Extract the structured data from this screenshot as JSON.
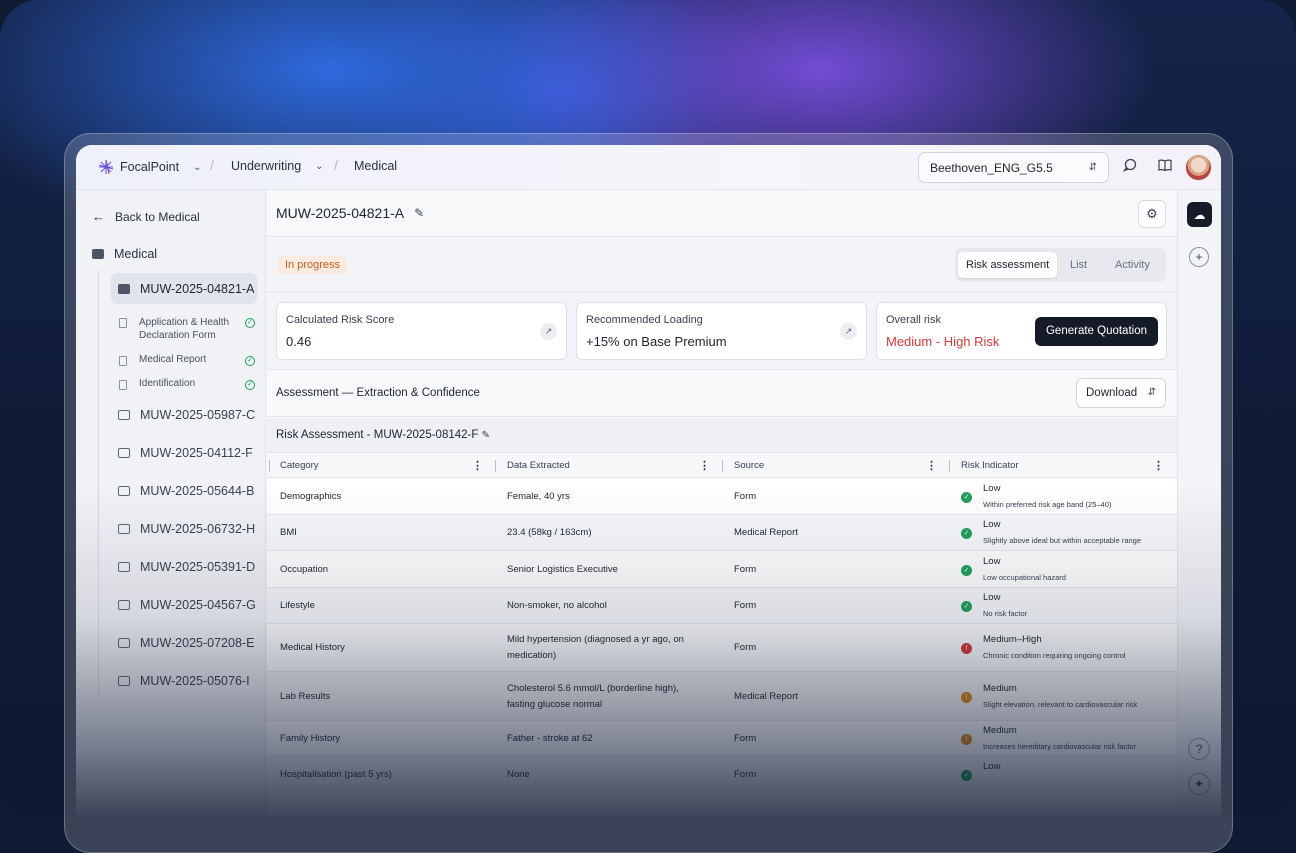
{
  "topbar": {
    "brand": "FocalPoint",
    "crumb2": "Underwriting",
    "crumb3": "Medical",
    "workspace": "Beethoven_ENG_G5.5"
  },
  "sidebar": {
    "back_label": "Back to Medical",
    "root_folder": "Medical",
    "active_case": "MUW-2025-04821-A",
    "documents": [
      {
        "label": "Application & Health Declaration Form"
      },
      {
        "label": "Medical Report"
      },
      {
        "label": "Identification"
      }
    ],
    "cases": [
      "MUW-2025-05987-C",
      "MUW-2025-04112-F",
      "MUW-2025-05644-B",
      "MUW-2025-06732-H",
      "MUW-2025-05391-D",
      "MUW-2025-04567-G",
      "MUW-2025-07208-E",
      "MUW-2025-05076-I"
    ]
  },
  "main": {
    "case_title": "MUW-2025-04821-A",
    "status": "In progress",
    "tabs": [
      "Risk assessment",
      "List",
      "Activity"
    ],
    "cards": {
      "score_label": "Calculated Risk Score",
      "score_value": "0.46",
      "loading_label": "Recommended Loading",
      "loading_value": "+15% on Base Premium",
      "overall_label": "Overall risk",
      "overall_value": "Medium - High Risk",
      "generate_button": "Generate Quotation"
    },
    "assessment_title": "Assessment — Extraction & Confidence",
    "download_label": "Download",
    "table_title": "Risk Assessment - MUW-2025-08142-F",
    "columns": [
      "Category",
      "Data Extracted",
      "Source",
      "Risk Indicator"
    ],
    "rows": [
      {
        "category": "Demographics",
        "data": "Female, 40 yrs",
        "source": "Form",
        "level": "Low",
        "desc": "Within preferred risk age band (25–40)",
        "status": "ok"
      },
      {
        "category": "BMI",
        "data": "23.4 (58kg / 163cm)",
        "source": "Medical Report",
        "level": "Low",
        "desc": "Slightly above ideal but within acceptable range",
        "status": "ok"
      },
      {
        "category": "Occupation",
        "data": "Senior Logistics Executive",
        "source": "Form",
        "level": "Low",
        "desc": "Low occupational hazard",
        "status": "ok"
      },
      {
        "category": "Lifestyle",
        "data": "Non-smoker, no alcohol",
        "source": "Form",
        "level": "Low",
        "desc": "No risk factor",
        "status": "ok"
      },
      {
        "category": "Medical History",
        "data": "Mild hypertension (diagnosed a yr ago, on medication)",
        "source": "Form",
        "level": "Medium–High",
        "desc": "Chronic condition requiring ongoing control",
        "status": "high"
      },
      {
        "category": "Lab Results",
        "data": "Cholesterol 5.6 mmol/L (borderline high), fasting glucose normal",
        "source": "Medical Report",
        "level": "Medium",
        "desc": "Slight elevation, relevant to cardiovascular risk",
        "status": "medium"
      },
      {
        "category": "Family History",
        "data": "Father - stroke at 62",
        "source": "Form",
        "level": "Medium",
        "desc": "Increases hereditary cardiovascular risk factor",
        "status": "medium"
      },
      {
        "category": "Hospitalisation (past 5 yrs)",
        "data": "None",
        "source": "Form",
        "level": "Low",
        "desc": "",
        "status": "ok"
      }
    ]
  },
  "colors": {
    "ok": "#22a05a",
    "high": "#d63a3a",
    "medium": "#d98a1f",
    "accent_dark": "#161b29"
  }
}
